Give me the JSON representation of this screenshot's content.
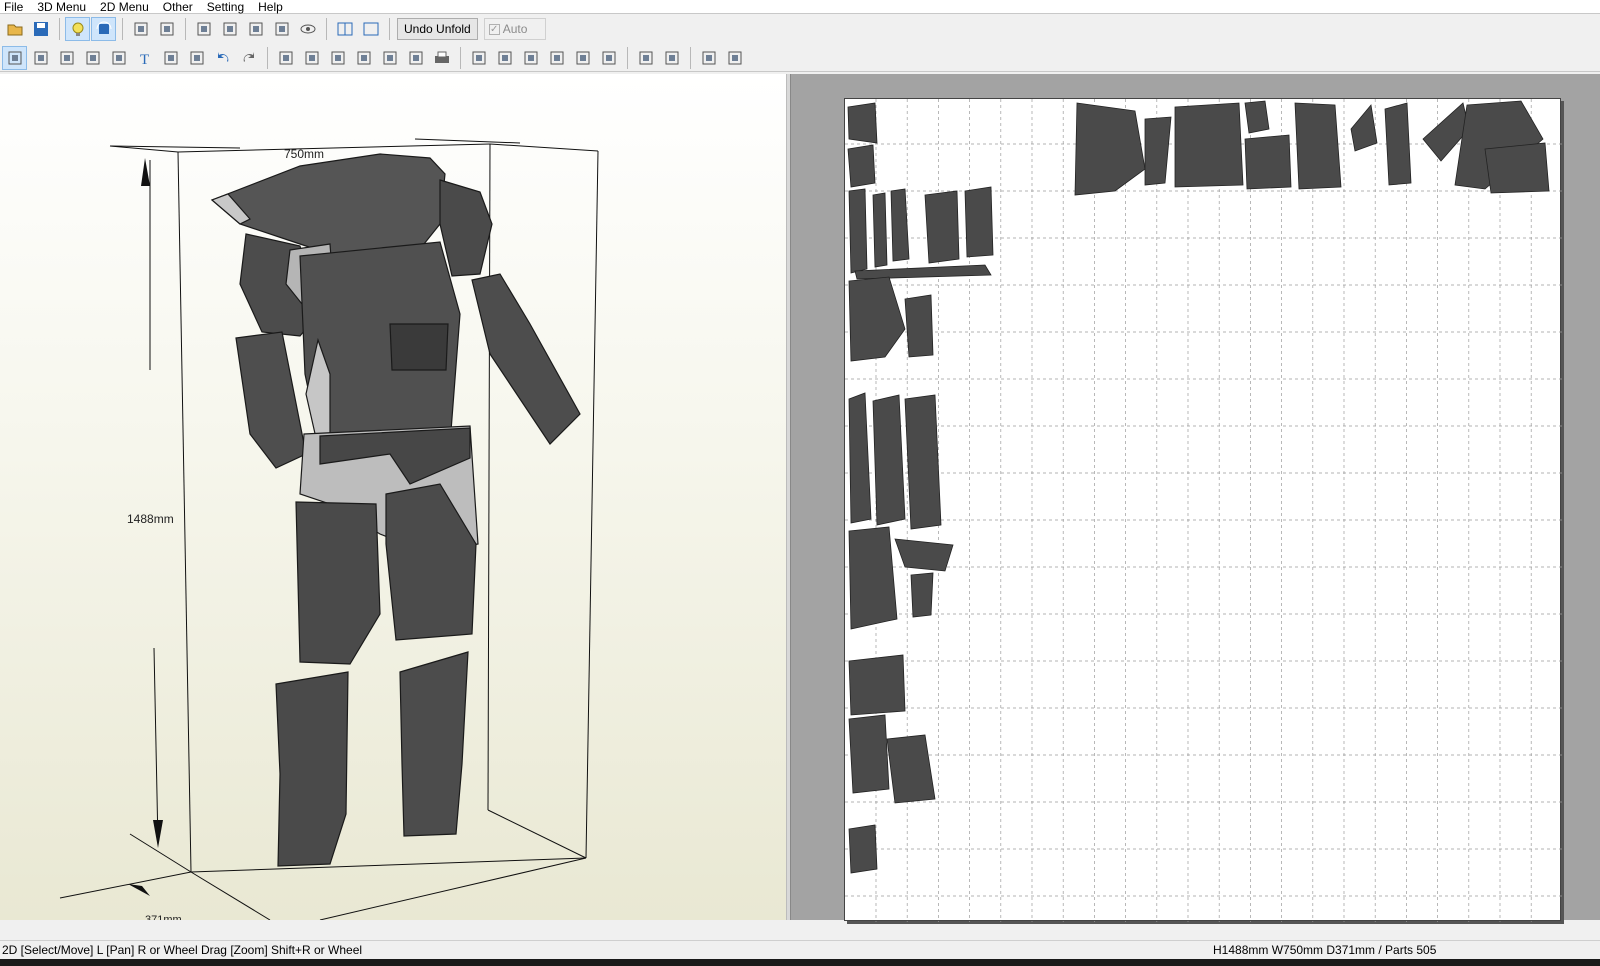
{
  "menu": [
    "File",
    "3D Menu",
    "2D Menu",
    "Other",
    "Setting",
    "Help"
  ],
  "toolbar1": {
    "icons": [
      "open-icon",
      "save-icon",
      "lightbulb-icon",
      "rotate-view-icon",
      "cube-shade-icon",
      "cube-edge-icon",
      "paint-icon",
      "cylinder-icon",
      "axis-icon",
      "columns-icon",
      "eye-icon",
      "split-view-icon",
      "single-view-icon"
    ],
    "undo_label": "Undo Unfold",
    "auto_label": "Auto",
    "auto_checked": true
  },
  "toolbar2": {
    "icons": [
      "select-move-icon",
      "rotate-icon",
      "join-icon",
      "edge-icon",
      "fold-line-icon",
      "text-icon",
      "image-icon",
      "box-icon",
      "undo-icon",
      "redo-icon",
      "book-icon",
      "zoom-fit-icon",
      "grid-icon",
      "page-icon",
      "page-export-icon",
      "capture-icon",
      "print-icon",
      "align-left-icon",
      "align-center-icon",
      "align-right-icon",
      "align-top-icon",
      "align-middle-icon",
      "align-bottom-icon",
      "flip-h-icon",
      "flip-v-icon",
      "fit-page-icon",
      "scatter-icon"
    ]
  },
  "view3d": {
    "width_label": "750mm",
    "height_label": "1488mm",
    "depth_label": "371mm"
  },
  "status": {
    "left": "2D [Select/Move] L [Pan] R or Wheel Drag [Zoom] Shift+R or Wheel",
    "right": "H1488mm W750mm D371mm / Parts 505"
  },
  "colors": {
    "part_fill": "#4a4a4a",
    "part_light": "#bdbdbd",
    "sheet_bg": "#a3a3a3",
    "grid_line": "#9a9a9a"
  }
}
